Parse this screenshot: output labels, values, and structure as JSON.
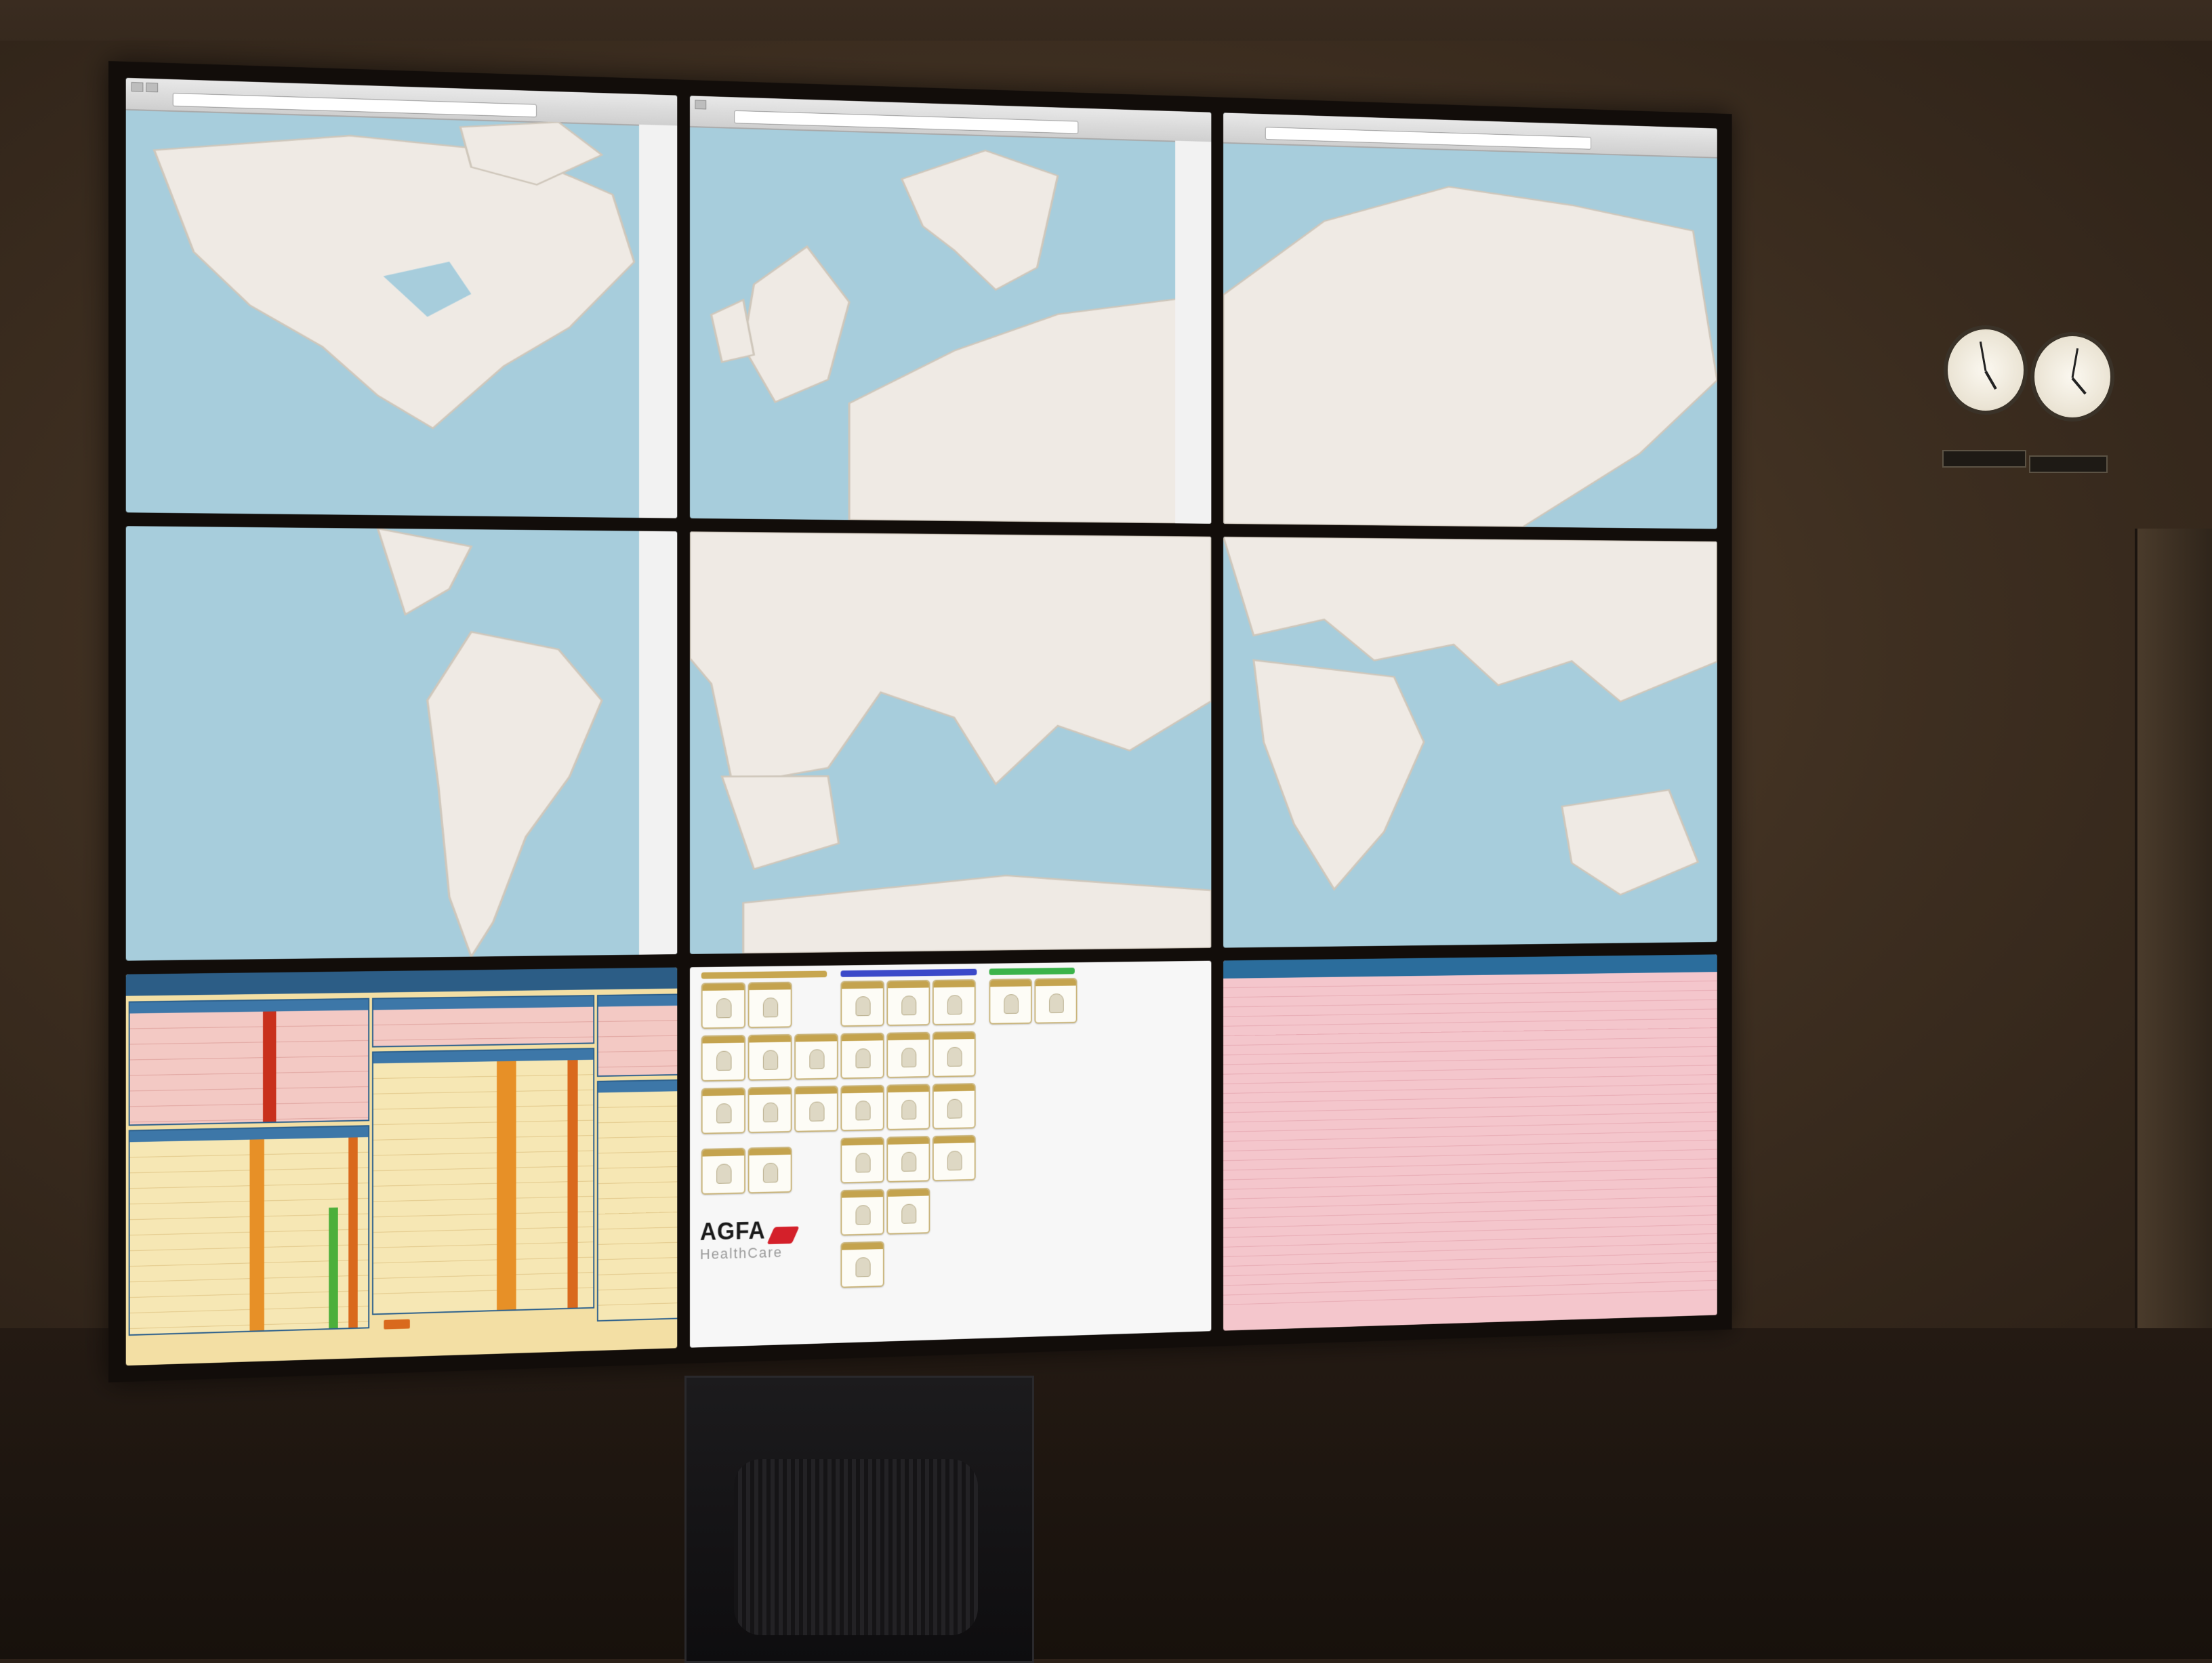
{
  "scene": {
    "description_tags": [
      "video-wall",
      "control-room",
      "world-maps",
      "status-dashboards",
      "wall-clocks",
      "equipment-cabinet"
    ]
  },
  "video_wall": {
    "rows": 3,
    "columns": 3
  },
  "map_screens": [
    {
      "region": "north-america"
    },
    {
      "region": "northern-europe"
    },
    {
      "region": "asia-russia"
    },
    {
      "region": "south-america"
    },
    {
      "region": "southern-europe"
    },
    {
      "region": "africa-asia-oceania"
    }
  ],
  "agfa_panel": {
    "brand_text": "AGFA",
    "sub_text": "HealthCare"
  },
  "colors": {
    "ocean": "#a7cddc",
    "land": "#efeae4",
    "dashboard_yellow": "#f3dfa4",
    "dashboard_red": "#f3c9c4",
    "header_blue": "#2c5d86",
    "status_orange": "#d9691d",
    "status_green": "#4caf3b",
    "agfa_red": "#d4202a"
  },
  "icons": [
    "clock-icon",
    "server-status-icon"
  ]
}
